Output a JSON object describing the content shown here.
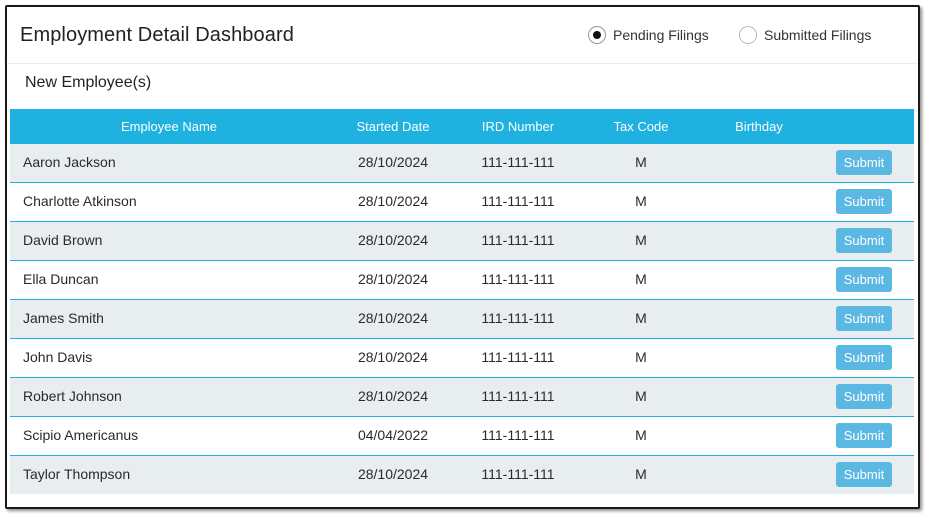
{
  "header": {
    "title": "Employment Detail Dashboard",
    "filters": [
      {
        "label": "Pending Filings",
        "checked": true
      },
      {
        "label": "Submitted Filings",
        "checked": false
      }
    ]
  },
  "section": {
    "title": "New Employee(s)"
  },
  "table": {
    "columns": [
      "Employee Name",
      "Started Date",
      "IRD Number",
      "Tax Code",
      "Birthday",
      ""
    ],
    "rows": [
      {
        "name": "Aaron Jackson",
        "started": "28/10/2024",
        "ird": "111-111-111",
        "tax_code": "M",
        "birthday": "",
        "action": "Submit"
      },
      {
        "name": "Charlotte Atkinson",
        "started": "28/10/2024",
        "ird": "111-111-111",
        "tax_code": "M",
        "birthday": "",
        "action": "Submit"
      },
      {
        "name": "David Brown",
        "started": "28/10/2024",
        "ird": "111-111-111",
        "tax_code": "M",
        "birthday": "",
        "action": "Submit"
      },
      {
        "name": "Ella Duncan",
        "started": "28/10/2024",
        "ird": "111-111-111",
        "tax_code": "M",
        "birthday": "",
        "action": "Submit"
      },
      {
        "name": "James Smith",
        "started": "28/10/2024",
        "ird": "111-111-111",
        "tax_code": "M",
        "birthday": "",
        "action": "Submit"
      },
      {
        "name": "John Davis",
        "started": "28/10/2024",
        "ird": "111-111-111",
        "tax_code": "M",
        "birthday": "",
        "action": "Submit"
      },
      {
        "name": "Robert Johnson",
        "started": "28/10/2024",
        "ird": "111-111-111",
        "tax_code": "M",
        "birthday": "",
        "action": "Submit"
      },
      {
        "name": "Scipio Americanus",
        "started": "04/04/2022",
        "ird": "111-111-111",
        "tax_code": "M",
        "birthday": "",
        "action": "Submit"
      },
      {
        "name": "Taylor Thompson",
        "started": "28/10/2024",
        "ird": "111-111-111",
        "tax_code": "M",
        "birthday": "",
        "action": "Submit"
      }
    ]
  },
  "colors": {
    "header_bg": "#1fb2e0",
    "row_alt": "#e8edf0",
    "button": "#5bb8e3"
  }
}
